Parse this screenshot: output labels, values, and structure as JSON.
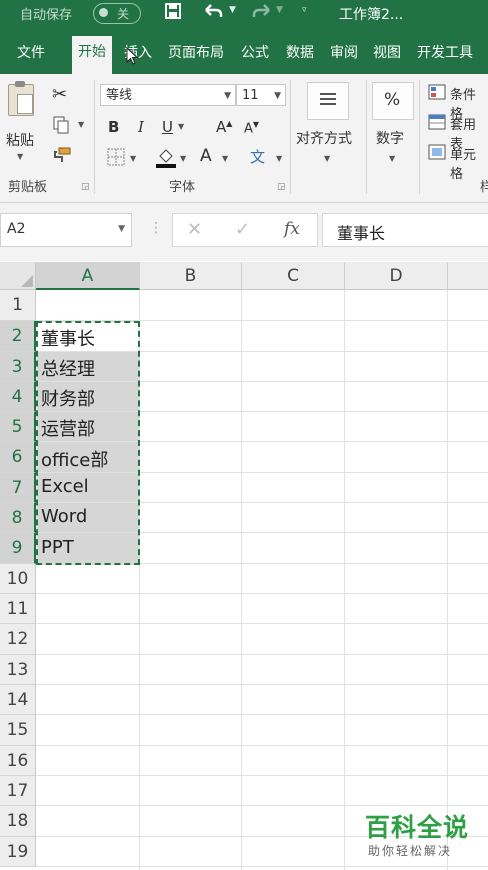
{
  "titlebar": {
    "autosave_label": "自动保存",
    "autosave_state": "关",
    "save_icon": "save-icon",
    "undo_icon": "undo-icon",
    "redo_icon": "redo-icon",
    "customize_icon": "customize-qat-icon",
    "doc_title": "工作簿2...",
    "colors": {
      "bar": "#217346",
      "text": "#ffffff"
    }
  },
  "tabs": [
    "文件",
    "开始",
    "插入",
    "页面布局",
    "公式",
    "数据",
    "审阅",
    "视图",
    "开发工具"
  ],
  "active_tab": "开始",
  "ribbon": {
    "clipboard": {
      "paste_label": "粘贴",
      "group_label": "剪贴板"
    },
    "font": {
      "font_name": "等线",
      "font_size": "11",
      "bold": "B",
      "italic": "I",
      "underline": "U",
      "grow": "A",
      "shrink": "A",
      "font_color": "A",
      "phonetic": "文",
      "group_label": "字体"
    },
    "alignment": {
      "label": "对齐方式"
    },
    "number": {
      "label": "数字",
      "symbol": "%"
    },
    "styles": {
      "items": [
        "条件格",
        "套用表",
        "单元格"
      ],
      "group_label_partial": "样"
    }
  },
  "formula_bar": {
    "name_box": "A2",
    "cancel_icon": "✕",
    "enter_icon": "✓",
    "fx": "fx",
    "content": "董事长"
  },
  "sheet": {
    "columns": [
      "A",
      "B",
      "C",
      "D"
    ],
    "selected_column": "A",
    "rows": [
      "1",
      "2",
      "3",
      "4",
      "5",
      "6",
      "7",
      "8",
      "9",
      "10",
      "11",
      "12",
      "13",
      "14",
      "15",
      "16",
      "17",
      "18",
      "19"
    ],
    "selected_rows": [
      "2",
      "3",
      "4",
      "5",
      "6",
      "7",
      "8",
      "9"
    ],
    "active_cell": "A2",
    "column_a_values": [
      "",
      "董事长",
      "总经理",
      "财务部",
      "运营部",
      "office部",
      "Excel",
      "Word",
      "PPT"
    ],
    "copy_range": "A2:A9"
  },
  "watermark": {
    "title": "百科全说",
    "subtitle": "助你轻松解决",
    "color": "#2ea044"
  }
}
